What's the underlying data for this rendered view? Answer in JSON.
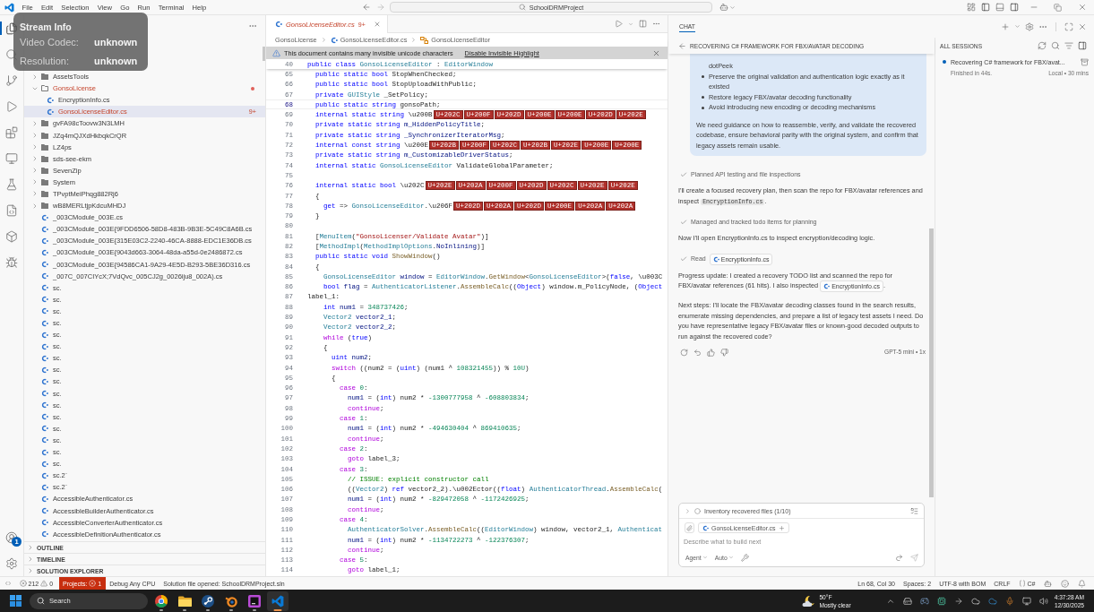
{
  "title_bar": {
    "menu": [
      "File",
      "Edit",
      "Selection",
      "View",
      "Go",
      "Run",
      "Terminal",
      "Help"
    ],
    "search": "SchoolDRMProject"
  },
  "stream_info": {
    "title": "Stream Info",
    "rows": [
      {
        "label": "Video Codec:",
        "value": "unknown"
      },
      {
        "label": "Resolution:",
        "value": "unknown"
      }
    ]
  },
  "activity_bar": {
    "items": [
      {
        "kind": "explorer",
        "selected": true
      },
      {
        "kind": "search",
        "selected": false
      },
      {
        "kind": "source_control",
        "selected": false
      },
      {
        "kind": "run",
        "selected": false
      },
      {
        "kind": "extensions",
        "selected": false
      },
      {
        "kind": "remote",
        "selected": false
      },
      {
        "kind": "testing",
        "selected": false
      },
      {
        "kind": "csharp",
        "selected": false
      },
      {
        "kind": "package",
        "selected": false
      },
      {
        "kind": "bug",
        "selected": false
      }
    ],
    "bottom_items": [
      {
        "kind": "accounts",
        "badge": "1"
      },
      {
        "kind": "settings"
      }
    ]
  },
  "explorer": {
    "tree": [
      {
        "kind": "folder",
        "name": "AssetsTools",
        "expanded": false,
        "selected": false,
        "error": false
      },
      {
        "kind": "folder",
        "name": "GonsoLicense",
        "expanded": true,
        "selected": false,
        "error": true,
        "children": [
          {
            "kind": "file",
            "name": "EncryptionInfo.cs",
            "selected": false,
            "error": false
          },
          {
            "kind": "file",
            "name": "GonsoLicenseEditor.cs",
            "selected": true,
            "error": true,
            "badge": "9+"
          }
        ]
      },
      {
        "kind": "folder",
        "name": "gvFA98cToovw3N3LMH",
        "expanded": false,
        "selected": false,
        "error": false
      },
      {
        "kind": "folder",
        "name": "JZq4mQJXdHkbqkCrQR",
        "expanded": false,
        "selected": false,
        "error": false
      },
      {
        "kind": "folder",
        "name": "LZ4ps",
        "expanded": false,
        "selected": false,
        "error": false
      },
      {
        "kind": "folder",
        "name": "sds-see-ekm",
        "expanded": false,
        "selected": false,
        "error": false
      },
      {
        "kind": "folder",
        "name": "SevenZip",
        "expanded": false,
        "selected": false,
        "error": false
      },
      {
        "kind": "folder",
        "name": "System",
        "expanded": false,
        "selected": false,
        "error": false
      },
      {
        "kind": "folder",
        "name": "TPvptMeiPhqg882Rj6",
        "expanded": false,
        "selected": false,
        "error": false
      },
      {
        "kind": "folder",
        "name": "wB8MERLtjpKdcuMHDJ",
        "expanded": false,
        "selected": false,
        "error": false
      },
      {
        "kind": "file",
        "name": "_003CModule_003E.cs",
        "selected": false,
        "error": false
      },
      {
        "kind": "file",
        "name": "_003CModule_003E{9FDD6506-58D8-483B-9B3E-5C49C8A6B.cs",
        "selected": false,
        "error": false
      },
      {
        "kind": "file",
        "name": "_003CModule_003E{315E03C2-2240-46CA-8888-EDC1E36DB.cs",
        "selected": false,
        "error": false
      },
      {
        "kind": "file",
        "name": "_003CModule_003E{9043d663-3064-48da-a55d-0e2486872.cs",
        "selected": false,
        "error": false
      },
      {
        "kind": "file",
        "name": "_003CModule_003E{94586CA1-9A29-4E5D-B293-5BE36D316.cs",
        "selected": false,
        "error": false
      },
      {
        "kind": "file",
        "name": "_007C_007CIYcX;7VdQvc_005CJ2g_0026iju8_002A).cs",
        "selected": false,
        "error": false
      },
      {
        "kind": "file",
        "name": "sc.",
        "selected": false,
        "error": false
      },
      {
        "kind": "file",
        "name": "sc.",
        "selected": false,
        "error": false
      },
      {
        "kind": "file",
        "name": "sc.",
        "selected": false,
        "error": false
      },
      {
        "kind": "file",
        "name": "sc.",
        "selected": false,
        "error": false
      },
      {
        "kind": "file",
        "name": "sc.",
        "selected": false,
        "error": false
      },
      {
        "kind": "file",
        "name": "sc.",
        "selected": false,
        "error": false
      },
      {
        "kind": "file",
        "name": "sc.",
        "selected": false,
        "error": false
      },
      {
        "kind": "file",
        "name": "sc.",
        "selected": false,
        "error": false
      },
      {
        "kind": "file",
        "name": "sc.",
        "selected": false,
        "error": false
      },
      {
        "kind": "file",
        "name": "sc.",
        "selected": false,
        "error": false
      },
      {
        "kind": "file",
        "name": "sc.",
        "selected": false,
        "error": false
      },
      {
        "kind": "file",
        "name": "sc.",
        "selected": false,
        "error": false
      },
      {
        "kind": "file",
        "name": "sc.",
        "selected": false,
        "error": false
      },
      {
        "kind": "file",
        "name": "sc.",
        "selected": false,
        "error": false
      },
      {
        "kind": "file",
        "name": "sc.",
        "selected": false,
        "error": false
      },
      {
        "kind": "file",
        "name": "sc.",
        "selected": false,
        "error": false
      },
      {
        "kind": "file",
        "name": "sc.2`",
        "selected": false,
        "error": false
      },
      {
        "kind": "file",
        "name": "sc.2`",
        "selected": false,
        "error": false
      },
      {
        "kind": "file",
        "name": "AccessibleAuthenticator.cs",
        "selected": false,
        "error": false
      },
      {
        "kind": "file",
        "name": "AccessibleBuilderAuthenticator.cs",
        "selected": false,
        "error": false
      },
      {
        "kind": "file",
        "name": "AccessibleConverterAuthenticator.cs",
        "selected": false,
        "error": false
      },
      {
        "kind": "file",
        "name": "AccessibleDefinitionAuthenticator.cs",
        "selected": false,
        "error": false
      }
    ],
    "sections": [
      {
        "label": "OUTLINE",
        "expanded": false
      },
      {
        "label": "TIMELINE",
        "expanded": false
      },
      {
        "label": "SOLUTION EXPLORER",
        "expanded": false
      }
    ]
  },
  "editor": {
    "tab": {
      "label": "GonsoLicenseEditor.cs",
      "badge": "9+",
      "selected": true,
      "error": true
    },
    "breadcrumbs": [
      {
        "kind": "folder",
        "label": "GonsoLicense"
      },
      {
        "kind": "file",
        "label": "GonsoLicenseEditor.cs"
      },
      {
        "kind": "class",
        "label": "GonsoLicenseEditor"
      }
    ],
    "banner": {
      "message": "This document contains many invisible unicode characters",
      "action": "Disable Invisible Highlight"
    },
    "sticky_line": {
      "number": "40",
      "tokens": [
        {
          "kind": "keyword",
          "text": "public class "
        },
        {
          "kind": "type",
          "text": "GonsoLicenseEditor"
        },
        {
          "kind": "plain",
          "text": " : "
        },
        {
          "kind": "type",
          "text": "EditorWindow"
        }
      ]
    },
    "lines": [
      {
        "number": "65",
        "current": false,
        "tokens": [
          {
            "kind": "keyword",
            "text": "  public static bool "
          },
          {
            "kind": "plain",
            "text": "StopWhenChecked;"
          }
        ]
      },
      {
        "number": "66",
        "current": false,
        "tokens": [
          {
            "kind": "keyword",
            "text": "  public static bool "
          },
          {
            "kind": "plain",
            "text": "StopUploadWithPublic;"
          }
        ]
      },
      {
        "number": "67",
        "current": false,
        "tokens": [
          {
            "kind": "keyword",
            "text": "  private "
          },
          {
            "kind": "type",
            "text": "GUIStyle"
          },
          {
            "kind": "plain",
            "text": " _SetPolicy;"
          }
        ]
      },
      {
        "number": "68",
        "current": true,
        "tokens": [
          {
            "kind": "keyword",
            "text": "  public static string "
          },
          {
            "kind": "plain",
            "text": "gonsoPath;"
          }
        ]
      },
      {
        "number": "69",
        "current": false,
        "tokens": [
          {
            "kind": "keyword",
            "text": "  internal static string "
          },
          {
            "kind": "plain",
            "text": "\\u200B"
          },
          {
            "kind": "invisible",
            "text": "U+202C"
          },
          {
            "kind": "invisible",
            "text": "U+200F"
          },
          {
            "kind": "invisible",
            "text": "U+202D"
          },
          {
            "kind": "invisible",
            "text": "U+200E"
          },
          {
            "kind": "invisible",
            "text": "U+200E"
          },
          {
            "kind": "invisible",
            "text": "U+202D"
          },
          {
            "kind": "invisible",
            "text": "U+202E"
          }
        ]
      },
      {
        "number": "70",
        "current": false,
        "tokens": [
          {
            "kind": "keyword",
            "text": "  private static string "
          },
          {
            "kind": "field",
            "text": "m_HiddenPolicyTitle"
          },
          {
            "kind": "plain",
            "text": ";"
          }
        ]
      },
      {
        "number": "71",
        "current": false,
        "tokens": [
          {
            "kind": "keyword",
            "text": "  private static string "
          },
          {
            "kind": "field",
            "text": "_SynchronizerIteratorMsg"
          },
          {
            "kind": "plain",
            "text": ";"
          }
        ]
      },
      {
        "number": "72",
        "current": false,
        "tokens": [
          {
            "kind": "keyword",
            "text": "  internal const string "
          },
          {
            "kind": "plain",
            "text": "\\u200E"
          },
          {
            "kind": "invisible",
            "text": "U+202B"
          },
          {
            "kind": "invisible",
            "text": "U+200F"
          },
          {
            "kind": "invisible",
            "text": "U+202C"
          },
          {
            "kind": "invisible",
            "text": "U+202B"
          },
          {
            "kind": "invisible",
            "text": "U+202E"
          },
          {
            "kind": "invisible",
            "text": "U+200E"
          },
          {
            "kind": "invisible",
            "text": "U+200E"
          }
        ]
      },
      {
        "number": "73",
        "current": false,
        "tokens": [
          {
            "kind": "keyword",
            "text": "  private static string "
          },
          {
            "kind": "field",
            "text": "m_CustomizableDriverStatus"
          },
          {
            "kind": "plain",
            "text": ";"
          }
        ]
      },
      {
        "number": "74",
        "current": false,
        "tokens": [
          {
            "kind": "keyword",
            "text": "  internal static "
          },
          {
            "kind": "type",
            "text": "GonsoLicenseEditor"
          },
          {
            "kind": "plain",
            "text": " ValidateGlobalParameter;"
          }
        ]
      },
      {
        "number": "75",
        "current": false
      },
      {
        "number": "76",
        "current": false,
        "tokens": [
          {
            "kind": "keyword",
            "text": "  internal static bool "
          },
          {
            "kind": "plain",
            "text": "\\u202C"
          },
          {
            "kind": "invisible",
            "text": "U+202E"
          },
          {
            "kind": "invisible",
            "text": "U+202A"
          },
          {
            "kind": "invisible",
            "text": "U+200F"
          },
          {
            "kind": "invisible",
            "text": "U+202D"
          },
          {
            "kind": "invisible",
            "text": "U+202C"
          },
          {
            "kind": "invisible",
            "text": "U+202E"
          },
          {
            "kind": "invisible",
            "text": "U+202E"
          }
        ]
      },
      {
        "number": "77",
        "current": false,
        "tokens": [
          {
            "kind": "plain",
            "text": "  {"
          }
        ]
      },
      {
        "number": "78",
        "current": false,
        "tokens": [
          {
            "kind": "keyword",
            "text": "    get"
          },
          {
            "kind": "plain",
            "text": " => "
          },
          {
            "kind": "type",
            "text": "GonsoLicenseEditor"
          },
          {
            "kind": "plain",
            "text": ".\\u206F"
          },
          {
            "kind": "invisible",
            "text": "U+202D"
          },
          {
            "kind": "invisible",
            "text": "U+202A"
          },
          {
            "kind": "invisible",
            "text": "U+202D"
          },
          {
            "kind": "invisible",
            "text": "U+200E"
          },
          {
            "kind": "invisible",
            "text": "U+202A"
          },
          {
            "kind": "invisible",
            "text": "U+202A"
          }
        ]
      },
      {
        "number": "79",
        "current": false,
        "tokens": [
          {
            "kind": "plain",
            "text": "  }"
          }
        ]
      },
      {
        "number": "80",
        "current": false
      },
      {
        "number": "81",
        "current": false,
        "tokens": [
          {
            "kind": "plain",
            "text": "  ["
          },
          {
            "kind": "type",
            "text": "MenuItem"
          },
          {
            "kind": "plain",
            "text": "("
          },
          {
            "kind": "string",
            "text": "\"GonsoLicenser/Validate Avatar\""
          },
          {
            "kind": "plain",
            "text": ")]"
          }
        ]
      },
      {
        "number": "82",
        "current": false,
        "tokens": [
          {
            "kind": "plain",
            "text": "  ["
          },
          {
            "kind": "type",
            "text": "MethodImpl"
          },
          {
            "kind": "plain",
            "text": "("
          },
          {
            "kind": "type",
            "text": "MethodImplOptions"
          },
          {
            "kind": "plain",
            "text": "."
          },
          {
            "kind": "field",
            "text": "NoInlining"
          },
          {
            "kind": "plain",
            "text": ")]"
          }
        ]
      },
      {
        "number": "83",
        "current": false,
        "tokens": [
          {
            "kind": "keyword",
            "text": "  public static void "
          },
          {
            "kind": "method",
            "text": "ShowWindow"
          },
          {
            "kind": "plain",
            "text": "()"
          }
        ]
      },
      {
        "number": "84",
        "current": false,
        "tokens": [
          {
            "kind": "plain",
            "text": "  {"
          }
        ]
      },
      {
        "number": "85",
        "current": false,
        "tokens": [
          {
            "kind": "type",
            "text": "    GonsoLicenseEditor"
          },
          {
            "kind": "field",
            "text": " window"
          },
          {
            "kind": "plain",
            "text": " = "
          },
          {
            "kind": "type",
            "text": "EditorWindow"
          },
          {
            "kind": "plain",
            "text": "."
          },
          {
            "kind": "method",
            "text": "GetWindow"
          },
          {
            "kind": "plain",
            "text": "<"
          },
          {
            "kind": "type",
            "text": "GonsoLicenseEditor"
          },
          {
            "kind": "plain",
            "text": ">("
          },
          {
            "kind": "keyword",
            "text": "false"
          },
          {
            "kind": "plain",
            "text": ", \\u003C"
          }
        ]
      },
      {
        "number": "86",
        "current": false,
        "tokens": [
          {
            "kind": "keyword",
            "text": "    bool"
          },
          {
            "kind": "field",
            "text": " flag"
          },
          {
            "kind": "plain",
            "text": " = "
          },
          {
            "kind": "type",
            "text": "AuthenticatorListener"
          },
          {
            "kind": "plain",
            "text": "."
          },
          {
            "kind": "method",
            "text": "AssembleCalc"
          },
          {
            "kind": "plain",
            "text": "(("
          },
          {
            "kind": "keyword",
            "text": "Object"
          },
          {
            "kind": "plain",
            "text": ") window.m_PolicyNode, ("
          },
          {
            "kind": "keyword",
            "text": "Object"
          }
        ]
      },
      {
        "number": "87",
        "current": false,
        "tokens": [
          {
            "kind": "plain",
            "text": "label_1:"
          }
        ]
      },
      {
        "number": "88",
        "current": false,
        "tokens": [
          {
            "kind": "keyword",
            "text": "    int"
          },
          {
            "kind": "field",
            "text": " num1"
          },
          {
            "kind": "plain",
            "text": " = "
          },
          {
            "kind": "number",
            "text": "348737426"
          },
          {
            "kind": "plain",
            "text": ";"
          }
        ]
      },
      {
        "number": "89",
        "current": false,
        "tokens": [
          {
            "kind": "type",
            "text": "    Vector2"
          },
          {
            "kind": "field",
            "text": " vector2_1"
          },
          {
            "kind": "plain",
            "text": ";"
          }
        ]
      },
      {
        "number": "90",
        "current": false,
        "tokens": [
          {
            "kind": "type",
            "text": "    Vector2"
          },
          {
            "kind": "field",
            "text": " vector2_2"
          },
          {
            "kind": "plain",
            "text": ";"
          }
        ]
      },
      {
        "number": "91",
        "current": false,
        "tokens": [
          {
            "kind": "control",
            "text": "    while"
          },
          {
            "kind": "plain",
            "text": " ("
          },
          {
            "kind": "keyword",
            "text": "true"
          },
          {
            "kind": "plain",
            "text": ")"
          }
        ]
      },
      {
        "number": "92",
        "current": false,
        "tokens": [
          {
            "kind": "plain",
            "text": "    {"
          }
        ]
      },
      {
        "number": "93",
        "current": false,
        "tokens": [
          {
            "kind": "keyword",
            "text": "      uint"
          },
          {
            "kind": "field",
            "text": " num2"
          },
          {
            "kind": "plain",
            "text": ";"
          }
        ]
      },
      {
        "number": "94",
        "current": false,
        "tokens": [
          {
            "kind": "control",
            "text": "      switch"
          },
          {
            "kind": "plain",
            "text": " ((num2 = ("
          },
          {
            "kind": "keyword",
            "text": "uint"
          },
          {
            "kind": "plain",
            "text": ") (num1 ^ "
          },
          {
            "kind": "number",
            "text": "108321455"
          },
          {
            "kind": "plain",
            "text": ")) % "
          },
          {
            "kind": "number",
            "text": "10U"
          },
          {
            "kind": "plain",
            "text": ")"
          }
        ]
      },
      {
        "number": "95",
        "current": false,
        "tokens": [
          {
            "kind": "plain",
            "text": "      {"
          }
        ]
      },
      {
        "number": "96",
        "current": false,
        "tokens": [
          {
            "kind": "control",
            "text": "        case "
          },
          {
            "kind": "number",
            "text": "0"
          },
          {
            "kind": "plain",
            "text": ":"
          }
        ]
      },
      {
        "number": "97",
        "current": false,
        "tokens": [
          {
            "kind": "field",
            "text": "          num1"
          },
          {
            "kind": "plain",
            "text": " = ("
          },
          {
            "kind": "keyword",
            "text": "int"
          },
          {
            "kind": "plain",
            "text": ") num2 * "
          },
          {
            "kind": "number",
            "text": "-1300777958"
          },
          {
            "kind": "plain",
            "text": " ^ "
          },
          {
            "kind": "number",
            "text": "-608803834"
          },
          {
            "kind": "plain",
            "text": ";"
          }
        ]
      },
      {
        "number": "98",
        "current": false,
        "tokens": [
          {
            "kind": "control",
            "text": "          continue"
          },
          {
            "kind": "plain",
            "text": ";"
          }
        ]
      },
      {
        "number": "99",
        "current": false,
        "tokens": [
          {
            "kind": "control",
            "text": "        case "
          },
          {
            "kind": "number",
            "text": "1"
          },
          {
            "kind": "plain",
            "text": ":"
          }
        ]
      },
      {
        "number": "100",
        "current": false,
        "tokens": [
          {
            "kind": "field",
            "text": "          num1"
          },
          {
            "kind": "plain",
            "text": " = ("
          },
          {
            "kind": "keyword",
            "text": "int"
          },
          {
            "kind": "plain",
            "text": ") num2 * "
          },
          {
            "kind": "number",
            "text": "-494630404"
          },
          {
            "kind": "plain",
            "text": " ^ "
          },
          {
            "kind": "number",
            "text": "869410635"
          },
          {
            "kind": "plain",
            "text": ";"
          }
        ]
      },
      {
        "number": "101",
        "current": false,
        "tokens": [
          {
            "kind": "control",
            "text": "          continue"
          },
          {
            "kind": "plain",
            "text": ";"
          }
        ]
      },
      {
        "number": "102",
        "current": false,
        "tokens": [
          {
            "kind": "control",
            "text": "        case "
          },
          {
            "kind": "number",
            "text": "2"
          },
          {
            "kind": "plain",
            "text": ":"
          }
        ]
      },
      {
        "number": "103",
        "current": false,
        "tokens": [
          {
            "kind": "control",
            "text": "          goto"
          },
          {
            "kind": "plain",
            "text": " label_3;"
          }
        ]
      },
      {
        "number": "104",
        "current": false,
        "tokens": [
          {
            "kind": "control",
            "text": "        case "
          },
          {
            "kind": "number",
            "text": "3"
          },
          {
            "kind": "plain",
            "text": ":"
          }
        ]
      },
      {
        "number": "105",
        "current": false,
        "tokens": [
          {
            "kind": "comment",
            "text": "          // ISSUE: explicit constructor call"
          }
        ]
      },
      {
        "number": "106",
        "current": false,
        "tokens": [
          {
            "kind": "plain",
            "text": "          (("
          },
          {
            "kind": "type",
            "text": "Vector2"
          },
          {
            "kind": "plain",
            "text": ") "
          },
          {
            "kind": "keyword",
            "text": "ref"
          },
          {
            "kind": "plain",
            "text": " vector2_2).\\u002Ector(("
          },
          {
            "kind": "keyword",
            "text": "float"
          },
          {
            "kind": "plain",
            "text": ") "
          },
          {
            "kind": "type",
            "text": "AuthenticatorThread"
          },
          {
            "kind": "plain",
            "text": "."
          },
          {
            "kind": "method",
            "text": "AssembleCalc"
          },
          {
            "kind": "plain",
            "text": "("
          }
        ]
      },
      {
        "number": "107",
        "current": false,
        "tokens": [
          {
            "kind": "field",
            "text": "          num1"
          },
          {
            "kind": "plain",
            "text": " = ("
          },
          {
            "kind": "keyword",
            "text": "int"
          },
          {
            "kind": "plain",
            "text": ") num2 * "
          },
          {
            "kind": "number",
            "text": "-829472058"
          },
          {
            "kind": "plain",
            "text": " ^ "
          },
          {
            "kind": "number",
            "text": "-1172426925"
          },
          {
            "kind": "plain",
            "text": ";"
          }
        ]
      },
      {
        "number": "108",
        "current": false,
        "tokens": [
          {
            "kind": "control",
            "text": "          continue"
          },
          {
            "kind": "plain",
            "text": ";"
          }
        ]
      },
      {
        "number": "109",
        "current": false,
        "tokens": [
          {
            "kind": "control",
            "text": "        case "
          },
          {
            "kind": "number",
            "text": "4"
          },
          {
            "kind": "plain",
            "text": ":"
          }
        ]
      },
      {
        "number": "110",
        "current": false,
        "tokens": [
          {
            "kind": "type",
            "text": "          AuthenticatorSolver"
          },
          {
            "kind": "plain",
            "text": "."
          },
          {
            "kind": "method",
            "text": "AssembleCalc"
          },
          {
            "kind": "plain",
            "text": "(("
          },
          {
            "kind": "type",
            "text": "EditorWindow"
          },
          {
            "kind": "plain",
            "text": ") window, vector2_1, "
          },
          {
            "kind": "type",
            "text": "Authenticat"
          }
        ]
      },
      {
        "number": "111",
        "current": false,
        "tokens": [
          {
            "kind": "field",
            "text": "          num1"
          },
          {
            "kind": "plain",
            "text": " = ("
          },
          {
            "kind": "keyword",
            "text": "int"
          },
          {
            "kind": "plain",
            "text": ") num2 * "
          },
          {
            "kind": "number",
            "text": "-1134722273"
          },
          {
            "kind": "plain",
            "text": " ^ "
          },
          {
            "kind": "number",
            "text": "-122376307"
          },
          {
            "kind": "plain",
            "text": ";"
          }
        ]
      },
      {
        "number": "112",
        "current": false,
        "tokens": [
          {
            "kind": "control",
            "text": "          continue"
          },
          {
            "kind": "plain",
            "text": ";"
          }
        ]
      },
      {
        "number": "113",
        "current": false,
        "tokens": [
          {
            "kind": "control",
            "text": "        case "
          },
          {
            "kind": "number",
            "text": "5"
          },
          {
            "kind": "plain",
            "text": ":"
          }
        ]
      },
      {
        "number": "114",
        "current": false,
        "tokens": [
          {
            "kind": "control",
            "text": "          goto"
          },
          {
            "kind": "plain",
            "text": " label_1;"
          }
        ]
      }
    ]
  },
  "chat": {
    "tab": {
      "label": "CHAT",
      "selected": true
    },
    "title": "RECOVERING C# FRAMEWORK FOR FBX/AVATAR DECODING",
    "request": {
      "continuation": "dotPeek",
      "bullets": [
        "Preserve the original validation and authentication logic exactly as it existed",
        "Restore legacy FBX/avatar decoding functionality",
        "Avoid introducing new encoding or decoding mechanisms"
      ],
      "paragraph": "We need guidance on how to reassemble, verify, and validate the recovered codebase, ensure behavioral parity with the original system, and confirm that legacy assets remain usable."
    },
    "response": [
      {
        "kind": "step",
        "text": "Planned API testing and file inspections"
      },
      {
        "kind": "paragraph",
        "parts": [
          {
            "kind": "text",
            "text": "I'll create a focused recovery plan, then scan the repo for FBX/avatar references and inspect "
          },
          {
            "kind": "code",
            "text": "EncryptionInfo.cs"
          },
          {
            "kind": "text",
            "text": "."
          }
        ]
      },
      {
        "kind": "step",
        "text": "Managed and tracked todo items for planning"
      },
      {
        "kind": "paragraph",
        "parts": [
          {
            "kind": "text",
            "text": "Now I'll open EncryptionInfo.cs to inspect encryption/decoding logic."
          }
        ]
      },
      {
        "kind": "step",
        "text": "Read",
        "file": "EncryptionInfo.cs"
      },
      {
        "kind": "paragraph",
        "parts": [
          {
            "kind": "text",
            "text": "Progress update: I created a recovery TODO list and scanned the repo for FBX/avatar references (61 hits). I also inspected "
          },
          {
            "kind": "file",
            "text": "EncryptionInfo.cs"
          },
          {
            "kind": "text",
            "text": "."
          }
        ]
      },
      {
        "kind": "paragraph",
        "parts": [
          {
            "kind": "text",
            "text": "Next steps: I'll locate the FBX/avatar decoding classes found in the search results, enumerate missing dependencies, and prepare a list of legacy test assets I need. Do you have representative legacy FBX/avatar files or known-good decoded outputs to run against the recovered code?"
          }
        ]
      }
    ],
    "model": "GPT-5 mini • 1x",
    "input": {
      "todo": "Inventory recovered files (1/10)",
      "attachment": "GonsoLicenseEditor.cs",
      "placeholder": "Describe what to build next",
      "mode": "Agent",
      "model": "Auto"
    }
  },
  "sessions": {
    "title": "ALL SESSIONS",
    "items": [
      {
        "title": "Recovering C# framework for FBX/avat...",
        "status": "Finished in 44s.",
        "meta": "Local • 30 mins",
        "unread": true
      }
    ]
  },
  "status_bar": {
    "errors": "212",
    "warnings": "0",
    "projects": {
      "label": "Projects:",
      "count": "1"
    },
    "configuration": "Debug Any CPU",
    "message": "Solution file opened: SchoolDRMProject.sln",
    "position": "Ln 68, Col 30",
    "indentation": "Spaces: 2",
    "encoding": "UTF-8 with BOM",
    "line_ending": "CRLF",
    "language": "C#"
  },
  "taskbar": {
    "search": "Search",
    "apps": [
      {
        "kind": "browser",
        "running": true,
        "active": false
      },
      {
        "kind": "files",
        "running": true,
        "active": false
      },
      {
        "kind": "steam",
        "running": true,
        "active": false
      },
      {
        "kind": "blender",
        "running": true,
        "active": false
      },
      {
        "kind": "ide",
        "running": true,
        "active": false
      },
      {
        "kind": "vscode",
        "running": true,
        "active": true
      }
    ],
    "weather": {
      "temperature": "50°F",
      "condition": "Mostly clear"
    },
    "clock": {
      "time": "4:37:28 AM",
      "date": "12/30/2025"
    }
  }
}
